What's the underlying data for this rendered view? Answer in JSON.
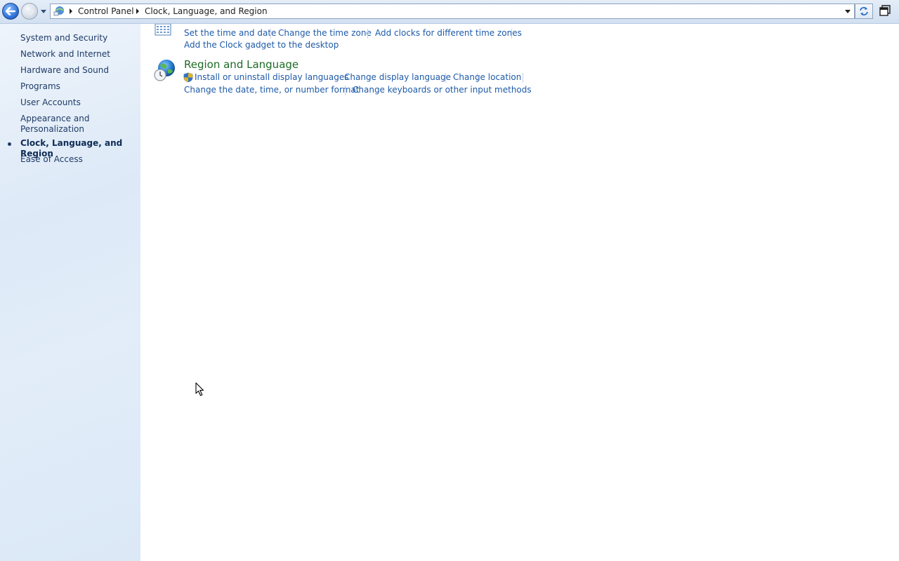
{
  "address_bar": {
    "breadcrumbs": [
      "Control Panel",
      "Clock, Language, and Region"
    ],
    "root_icon": "control-panel-icon"
  },
  "sidebar": {
    "items": [
      {
        "label": "System and Security"
      },
      {
        "label": "Network and Internet"
      },
      {
        "label": "Hardware and Sound"
      },
      {
        "label": "Programs"
      },
      {
        "label": "User Accounts"
      },
      {
        "label": "Appearance and"
      },
      {
        "label": "Personalization"
      },
      {
        "label": "Clock, Language, and Region",
        "current": true
      },
      {
        "label": "Ease of Access"
      }
    ]
  },
  "date_and_time": {
    "icon": "calendar-clock-icon",
    "links": [
      "Set the time and date",
      "Change the time zone",
      "Add clocks for different time zones",
      "Add the Clock gadget to the desktop"
    ]
  },
  "region_and_language": {
    "title": "Region and Language",
    "icon": "globe-clock-icon",
    "links": [
      "Install or uninstall display languages",
      "Change display language",
      "Change location",
      "Change the date, time, or number format",
      "Change keyboards or other input methods"
    ]
  },
  "colors": {
    "link": "#1e5aa8",
    "heading": "#1e6b26",
    "sidebar_text": "#1e3b66"
  }
}
